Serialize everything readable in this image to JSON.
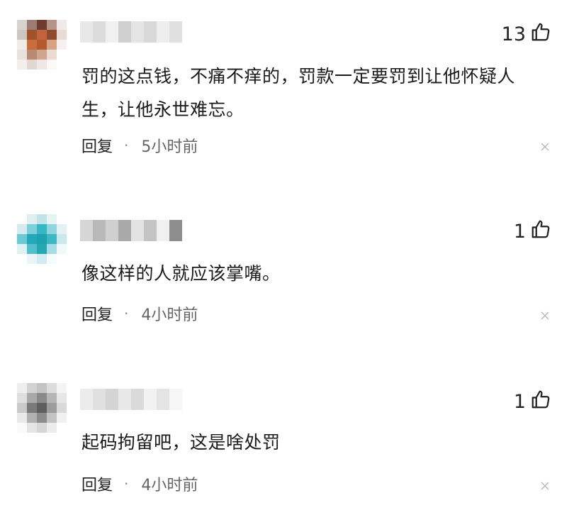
{
  "comments": [
    {
      "likes": "13",
      "text": "罚的这点钱，不痛不痒的，罚款一定要罚到让他怀疑人生，让他永世难忘。",
      "reply_label": "回复",
      "separator": "·",
      "time": "5小时前",
      "avatar_colors": [
        "#d9d2cf",
        "#9b7b72",
        "#6e3b2e",
        "#b69387",
        "#efe9e7",
        "#cfc5c1",
        "#a0522d",
        "#c0643c",
        "#8f4a2f",
        "#e8dad4",
        "#f1ebe8",
        "#c86d3e",
        "#b55a2f",
        "#d8a285",
        "#f6f1ee",
        "#e9e1dd",
        "#b88a74",
        "#cfa590",
        "#eadbd3",
        "#ffffff",
        "#f3eeeb",
        "#e2d6d0",
        "#efe7e3",
        "#fbf8f6",
        "#ffffff"
      ],
      "name_colors": [
        "#e8e8e8",
        "#dcdcdc",
        "#f0f0f0",
        "#cfcfcf",
        "#e4e4e4",
        "#d8d8d8",
        "#ededed",
        "#e0e0e0"
      ]
    },
    {
      "likes": "1",
      "text": "像这样的人就应该掌嘴。",
      "reply_label": "回复",
      "separator": "·",
      "time": "4小时前",
      "avatar_colors": [
        "#ffffff",
        "#dfeff1",
        "#bfe3e8",
        "#e6f3f5",
        "#ffffff",
        "#d5ebef",
        "#7ccfd9",
        "#36b8c4",
        "#8fd5dd",
        "#e2f2f4",
        "#6cc9d3",
        "#23a9b7",
        "#1ea2b0",
        "#3db7c3",
        "#c9e9ed",
        "#e0f1f3",
        "#52bfcb",
        "#27a6b4",
        "#a6dce3",
        "#f1f9fa",
        "#ffffff",
        "#e9f5f7",
        "#d0ecf0",
        "#f5fbfc",
        "#ffffff"
      ],
      "name_colors": [
        "#d6d6d6",
        "#b9b9b9",
        "#cfcfcf",
        "#a9a9a9",
        "#e3e3e3",
        "#c4c4c4",
        "#f0f0f0",
        "#8d8d8d"
      ]
    },
    {
      "likes": "1",
      "text": "起码拘留吧，这是啥处罚",
      "reply_label": "回复",
      "separator": "·",
      "time": "4小时前",
      "avatar_colors": [
        "#eeeeee",
        "#d2d2d2",
        "#c4c4c4",
        "#dcdcdc",
        "#f4f4f4",
        "#dedede",
        "#a9a9a9",
        "#8a8a8a",
        "#b5b5b5",
        "#e6e6e6",
        "#c9c9c9",
        "#7a7a7a",
        "#5e5e5e",
        "#9c9c9c",
        "#d9d9d9",
        "#e9e9e9",
        "#b1b1b1",
        "#8c8c8c",
        "#c3c3c3",
        "#f0f0f0",
        "#fafafa",
        "#e4e4e4",
        "#d6d6d6",
        "#ececec",
        "#ffffff"
      ],
      "name_colors": [
        "#ececec",
        "#e0e0e0",
        "#d4d4d4",
        "#e8e8e8",
        "#dadada",
        "#f2f2f2",
        "#e4e4e4",
        "#f6f6f6"
      ]
    }
  ]
}
